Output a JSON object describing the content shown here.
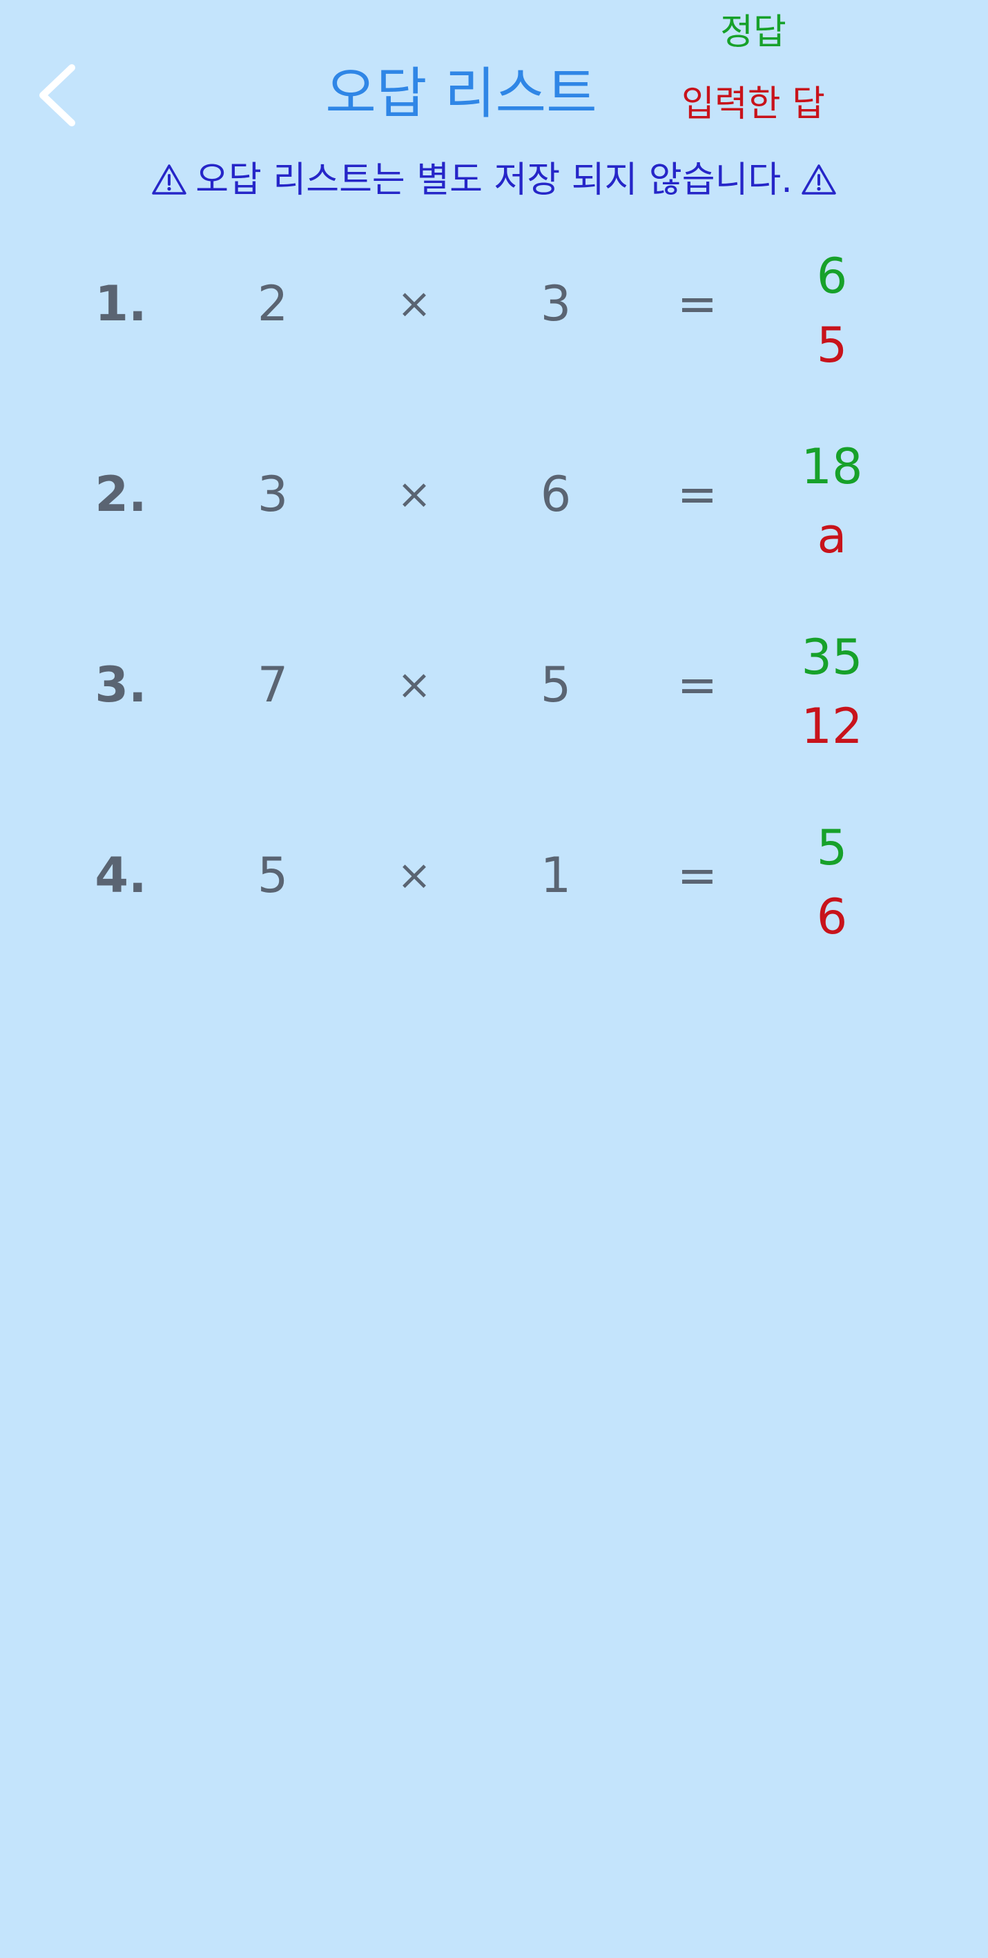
{
  "header": {
    "title": "오답 리스트",
    "back_icon": "chevron-left-icon"
  },
  "legend": {
    "correct_label": "정답",
    "input_label": "입력한 답"
  },
  "notice": {
    "text": "오답 리스트는 별도 저장 되지 않습니다.",
    "icon": "warning-icon"
  },
  "colors": {
    "background": "#c4e4fc",
    "title": "#2f86e6",
    "notice": "#2626c8",
    "correct": "#17a12a",
    "input": "#c8131b",
    "neutral": "#5a6472"
  },
  "problems": [
    {
      "number": "1.",
      "a": "2",
      "op": "×",
      "b": "3",
      "eq": "=",
      "correct": "6",
      "input": "5"
    },
    {
      "number": "2.",
      "a": "3",
      "op": "×",
      "b": "6",
      "eq": "=",
      "correct": "18",
      "input": "a"
    },
    {
      "number": "3.",
      "a": "7",
      "op": "×",
      "b": "5",
      "eq": "=",
      "correct": "35",
      "input": "12"
    },
    {
      "number": "4.",
      "a": "5",
      "op": "×",
      "b": "1",
      "eq": "=",
      "correct": "5",
      "input": "6"
    }
  ]
}
